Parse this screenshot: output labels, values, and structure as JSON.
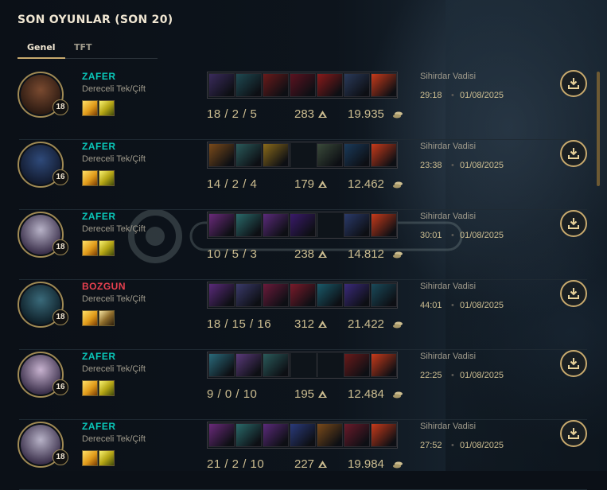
{
  "header": {
    "title": "SON OYUNLAR (SON 20)"
  },
  "tabs": [
    {
      "label": "Genel",
      "active": true
    },
    {
      "label": "TFT",
      "active": false
    }
  ],
  "colors": {
    "accent_gold": "#c8aa6e",
    "win": "#0ac8b9",
    "loss": "#e8404f",
    "background": "#0b1017"
  },
  "games": [
    {
      "result": "ZAFER",
      "outcome": "win",
      "queue": "Dereceli Tek/Çift",
      "level": "18",
      "champion_palette": [
        "#7a4a30",
        "#2b1a12"
      ],
      "spells": [
        "flash-spell-icon",
        "ignite-spell-icon"
      ],
      "items": [
        "#3a2b5c",
        "#1f4a52",
        "#6a1a1a",
        "#5b1220",
        "#8a1a1a",
        "#2a3a5a",
        "#c83a1a"
      ],
      "kda": "18 / 2 / 5",
      "cs": "283",
      "gold": "19.935",
      "map": "Sihirdar Vadisi",
      "duration": "29:18",
      "date": "01/08/2025"
    },
    {
      "result": "ZAFER",
      "outcome": "win",
      "queue": "Dereceli Tek/Çift",
      "level": "16",
      "champion_palette": [
        "#2f4a7a",
        "#121a2e"
      ],
      "spells": [
        "flash-spell-icon",
        "ignite-spell-icon"
      ],
      "items": [
        "#7a4a1a",
        "#2a5a5a",
        "#8a6a1a",
        "",
        "#3a4a3a",
        "#1a3a5a",
        "#c83a1a"
      ],
      "kda": "14 / 2 / 4",
      "cs": "179",
      "gold": "12.462",
      "map": "Sihirdar Vadisi",
      "duration": "23:38",
      "date": "01/08/2025"
    },
    {
      "result": "ZAFER",
      "outcome": "win",
      "queue": "Dereceli Tek/Çift",
      "level": "18",
      "champion_palette": [
        "#b7b2c7",
        "#3a2f4a"
      ],
      "spells": [
        "flash-spell-icon",
        "ignite-spell-icon"
      ],
      "items": [
        "#6a2a7a",
        "#2a6a6a",
        "#5a2a7a",
        "#3a1a6a",
        "",
        "#2a3a6a",
        "#c83a1a"
      ],
      "kda": "10 / 5 / 3",
      "cs": "238",
      "gold": "14.812",
      "map": "Sihirdar Vadisi",
      "duration": "30:01",
      "date": "01/08/2025"
    },
    {
      "result": "BOZGUN",
      "outcome": "loss",
      "queue": "Dereceli Tek/Çift",
      "level": "18",
      "champion_palette": [
        "#3a6a7a",
        "#0e1f28"
      ],
      "spells": [
        "flash-spell-icon",
        "teleport-spell-icon"
      ],
      "items": [
        "#5a2a7a",
        "#3a3a6a",
        "#6a1a3a",
        "#7a1a2a",
        "#1a5a6a",
        "#3a2a7a",
        "#1a4a5a"
      ],
      "kda": "18 / 15 / 16",
      "cs": "312",
      "gold": "21.422",
      "map": "Sihirdar Vadisi",
      "duration": "44:01",
      "date": "01/08/2025"
    },
    {
      "result": "ZAFER",
      "outcome": "win",
      "queue": "Dereceli Tek/Çift",
      "level": "16",
      "champion_palette": [
        "#c7b2cf",
        "#3a2f4a"
      ],
      "spells": [
        "flash-spell-icon",
        "ignite-spell-icon"
      ],
      "items": [
        "#2a6a7a",
        "#5a3a7a",
        "#2a5a5a",
        "",
        "",
        "#6a1a1a",
        "#c83a1a"
      ],
      "kda": "9 / 0 / 10",
      "cs": "195",
      "gold": "12.484",
      "map": "Sihirdar Vadisi",
      "duration": "22:25",
      "date": "01/08/2025"
    },
    {
      "result": "ZAFER",
      "outcome": "win",
      "queue": "Dereceli Tek/Çift",
      "level": "18",
      "champion_palette": [
        "#b7b2c7",
        "#3a2f4a"
      ],
      "spells": [
        "flash-spell-icon",
        "ignite-spell-icon"
      ],
      "items": [
        "#6a2a7a",
        "#2a6a6a",
        "#5a2a7a",
        "#2a3a7a",
        "#7a4a1a",
        "#6a1a2a",
        "#c83a1a"
      ],
      "kda": "21 / 2 / 10",
      "cs": "227",
      "gold": "19.984",
      "map": "Sihirdar Vadisi",
      "duration": "27:52",
      "date": "01/08/2025"
    }
  ]
}
